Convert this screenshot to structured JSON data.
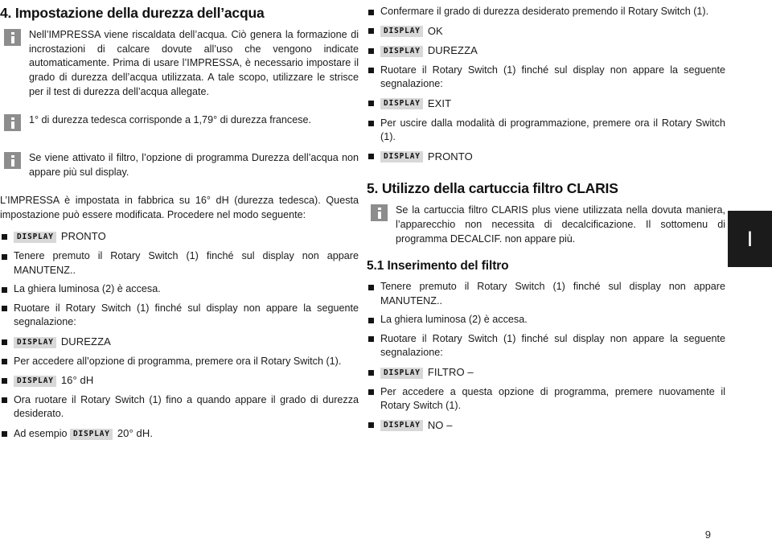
{
  "document": {
    "language_tab": "I",
    "page_number": "9"
  },
  "left_column": {
    "heading": "4. Impostazione della durezza dell’acqua",
    "notes": [
      {
        "icon": "info-icon",
        "text": "Nell’IMPRESSA viene riscaldata dell’acqua. Ciò genera la formazione di incrostazioni di calcare dovute all’uso che vengono indicate automaticamente. Prima di usare l’IMPRESSA, è necessario impostare il grado di durezza dell’acqua utilizzata. A tale scopo, utilizzare le strisce per il test di durezza dell’acqua allegate."
      },
      {
        "icon": "info-icon",
        "text": "1° di durezza tedesca corrisponde a 1,79° di durezza francese."
      },
      {
        "icon": "info-icon",
        "text": "Se viene attivato il filtro, l’opzione di programma Durezza dell’acqua non appare più sul display."
      }
    ],
    "paragraph": "L’IMPRESSA è impostata in fabbrica su 16° dH (durezza tedesca). Questa impostazione può essere modificata. Procedere nel modo seguente:",
    "steps": [
      {
        "type": "display",
        "tag": "DISPLAY",
        "value": "PRONTO"
      },
      {
        "type": "text",
        "text": "Tenere premuto il Rotary Switch (1) finché sul display non appare MANUTENZ.."
      },
      {
        "type": "text",
        "text": "La ghiera luminosa (2) è accesa."
      },
      {
        "type": "text",
        "text": "Ruotare il Rotary Switch (1) finché sul display non appare la seguente segnalazione:"
      },
      {
        "type": "display",
        "tag": "DISPLAY",
        "value": "DUREZZA"
      },
      {
        "type": "text",
        "text": "Per accedere all’opzione di programma, premere ora il Rotary Switch (1)."
      },
      {
        "type": "display",
        "tag": "DISPLAY",
        "value": "16° dH"
      },
      {
        "type": "text",
        "text": "Ora ruotare il Rotary Switch (1) fino a quando appare il grado di durezza desiderato."
      },
      {
        "type": "inline_display",
        "prefix": "Ad esempio",
        "tag": "DISPLAY",
        "value": "20° dH."
      }
    ]
  },
  "right_column": {
    "steps_top": [
      {
        "type": "text",
        "text": "Confermare il grado di durezza desiderato premendo il Rotary Switch (1)."
      },
      {
        "type": "display",
        "tag": "DISPLAY",
        "value": "OK"
      },
      {
        "type": "display",
        "tag": "DISPLAY",
        "value": "DUREZZA"
      },
      {
        "type": "text",
        "text": "Ruotare il Rotary Switch (1) finché sul display non appare la seguente segnalazione:"
      },
      {
        "type": "display",
        "tag": "DISPLAY",
        "value": "EXIT"
      },
      {
        "type": "text",
        "text": "Per uscire dalla modalità di programmazione, premere ora il Rotary Switch (1)."
      },
      {
        "type": "display",
        "tag": "DISPLAY",
        "value": "PRONTO"
      }
    ],
    "heading": "5. Utilizzo della cartuccia filtro CLARIS",
    "note": {
      "icon": "info-icon",
      "text": "Se la cartuccia filtro CLARIS plus viene utilizzata nella dovuta maniera, l’apparecchio non necessita di decalcificazione. Il sottomenu di programma DECALCIF. non appare più."
    },
    "subheading": "5.1 Inserimento del filtro",
    "steps_bottom": [
      {
        "type": "text",
        "text": "Tenere premuto il Rotary Switch (1) finché sul display non appare MANUTENZ.."
      },
      {
        "type": "text",
        "text": "La ghiera luminosa (2) è accesa."
      },
      {
        "type": "text",
        "text": "Ruotare il Rotary Switch (1) finché sul display non appare la seguente segnalazione:"
      },
      {
        "type": "display",
        "tag": "DISPLAY",
        "value": "FILTRO –"
      },
      {
        "type": "text",
        "text": "Per accedere a questa opzione di programma, premere nuovamente il Rotary Switch (1)."
      },
      {
        "type": "display",
        "tag": "DISPLAY",
        "value": "NO –"
      }
    ]
  }
}
